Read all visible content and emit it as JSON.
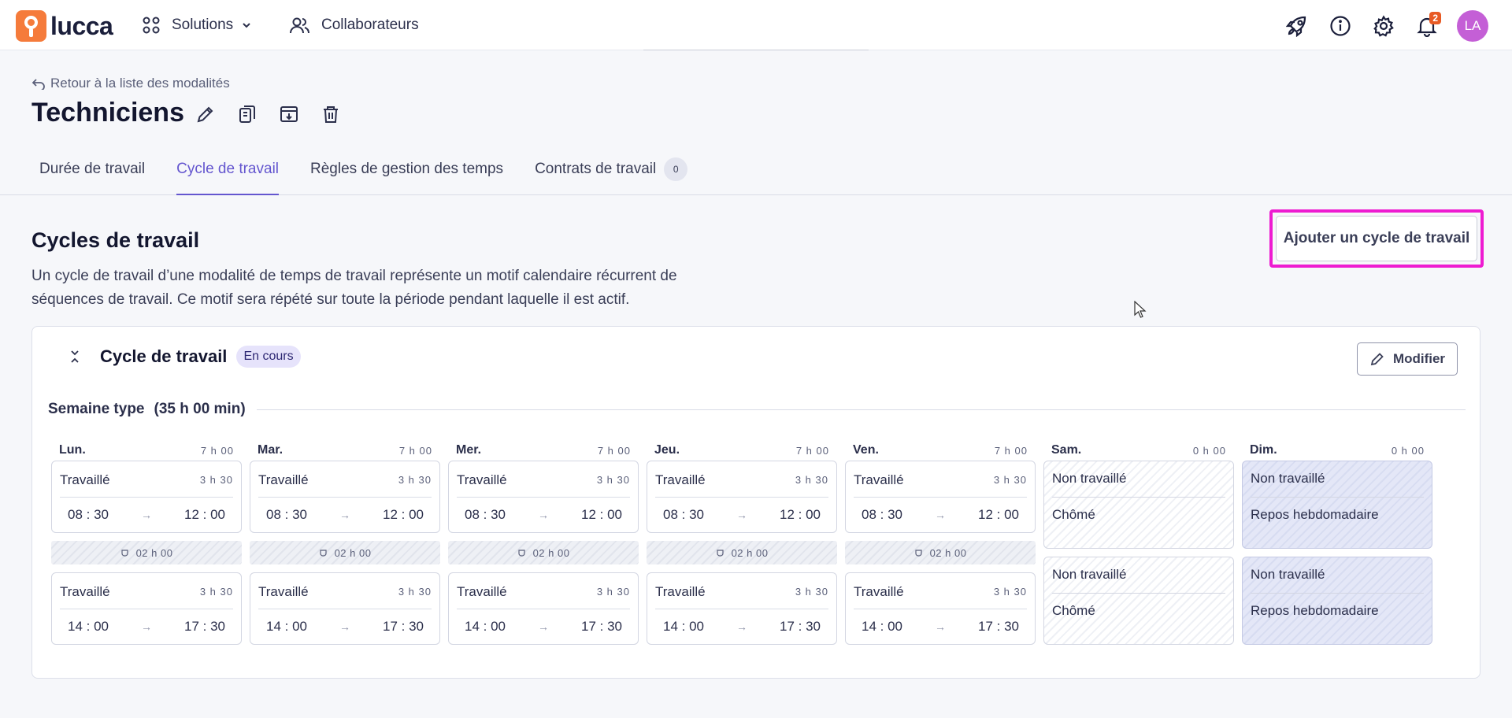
{
  "app": {
    "logo_text": "lucca",
    "nav": {
      "solutions": "Solutions",
      "collaborateurs": "Collaborateurs"
    },
    "notification_count": "2",
    "avatar_initials": "LA"
  },
  "header": {
    "back_link": "Retour à la liste des modalités",
    "title": "Techniciens",
    "tabs": [
      {
        "label": "Durée de travail"
      },
      {
        "label": "Cycle de travail"
      },
      {
        "label": "Règles de gestion des temps"
      },
      {
        "label": "Contrats de travail",
        "count": "0"
      }
    ]
  },
  "section": {
    "title": "Cycles de travail",
    "description": "Un cycle de travail d’une modalité de temps de travail représente un motif calendaire récurrent de séquences de travail. Ce motif sera répété sur toute la période pendant laquelle il est actif.",
    "add_button": "Ajouter un cycle de travail"
  },
  "cycle": {
    "title": "Cycle de travail",
    "status": "En cours",
    "edit_button": "Modifier",
    "week_title": "Semaine type",
    "week_total": "(35 h 00 min)",
    "days": [
      {
        "name": "Lun.",
        "hours": "7 h 00",
        "morning": {
          "label": "Travaillé",
          "duration": "3 h 30",
          "start": "08 : 30",
          "end": "12 : 00"
        },
        "break": "02 h 00",
        "afternoon": {
          "label": "Travaillé",
          "duration": "3 h 30",
          "start": "14 : 00",
          "end": "17 : 30"
        }
      },
      {
        "name": "Mar.",
        "hours": "7 h 00",
        "morning": {
          "label": "Travaillé",
          "duration": "3 h 30",
          "start": "08 : 30",
          "end": "12 : 00"
        },
        "break": "02 h 00",
        "afternoon": {
          "label": "Travaillé",
          "duration": "3 h 30",
          "start": "14 : 00",
          "end": "17 : 30"
        }
      },
      {
        "name": "Mer.",
        "hours": "7 h 00",
        "morning": {
          "label": "Travaillé",
          "duration": "3 h 30",
          "start": "08 : 30",
          "end": "12 : 00"
        },
        "break": "02 h 00",
        "afternoon": {
          "label": "Travaillé",
          "duration": "3 h 30",
          "start": "14 : 00",
          "end": "17 : 30"
        }
      },
      {
        "name": "Jeu.",
        "hours": "7 h 00",
        "morning": {
          "label": "Travaillé",
          "duration": "3 h 30",
          "start": "08 : 30",
          "end": "12 : 00"
        },
        "break": "02 h 00",
        "afternoon": {
          "label": "Travaillé",
          "duration": "3 h 30",
          "start": "14 : 00",
          "end": "17 : 30"
        }
      },
      {
        "name": "Ven.",
        "hours": "7 h 00",
        "morning": {
          "label": "Travaillé",
          "duration": "3 h 30",
          "start": "08 : 30",
          "end": "12 : 00"
        },
        "break": "02 h 00",
        "afternoon": {
          "label": "Travaillé",
          "duration": "3 h 30",
          "start": "14 : 00",
          "end": "17 : 30"
        }
      },
      {
        "name": "Sam.",
        "hours": "0 h 00",
        "off": [
          {
            "label": "Non travaillé",
            "type": "Chômé"
          },
          {
            "label": "Non travaillé",
            "type": "Chômé"
          }
        ]
      },
      {
        "name": "Dim.",
        "hours": "0 h 00",
        "off": [
          {
            "label": "Non travaillé",
            "type": "Repos hebdomadaire"
          },
          {
            "label": "Non travaillé",
            "type": "Repos hebdomadaire"
          }
        ]
      }
    ]
  },
  "icons": {
    "logo": "lucca-logo-icon",
    "solutions": "grid-icon",
    "collaborateurs": "users-icon",
    "rocket": "rocket-icon",
    "info": "info-icon",
    "settings": "gear-icon",
    "notifications": "bell-icon",
    "back": "back-arrow-icon",
    "edit": "pencil-icon",
    "duplicate": "copy-icon",
    "archive": "archive-icon",
    "delete": "trash-icon",
    "collapse": "collapse-icon",
    "break": "coffee-icon"
  },
  "colors": {
    "accent": "#6456cf",
    "brand": "#f57b3b",
    "highlight": "#ee1bd1",
    "avatar": "#c45fd6",
    "badge_bg": "#e6e3fb"
  }
}
